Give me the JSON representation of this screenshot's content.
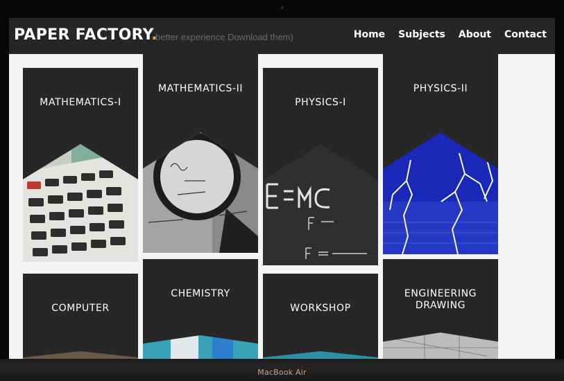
{
  "site": {
    "logo": "PAPER FACTORY",
    "logo_dot": ".",
    "notice": "better experience Download them)"
  },
  "nav": {
    "items": [
      "Home",
      "Subjects",
      "About",
      "Contact"
    ]
  },
  "subjects": [
    {
      "name": "MATHEMATICS-I"
    },
    {
      "name": "MATHEMATICS-II"
    },
    {
      "name": "PHYSICS-I"
    },
    {
      "name": "PHYSICS-II"
    },
    {
      "name": "COMPUTER"
    },
    {
      "name": "CHEMISTRY"
    },
    {
      "name": "WORKSHOP"
    },
    {
      "name": "ENGINEERING DRAWING"
    }
  ],
  "device_label": "MacBook Air",
  "colors": {
    "header_bg": "#262626",
    "card_bg": "#272727",
    "page_bg": "#f4f4f4",
    "logo_dot": "#e0a84c"
  }
}
